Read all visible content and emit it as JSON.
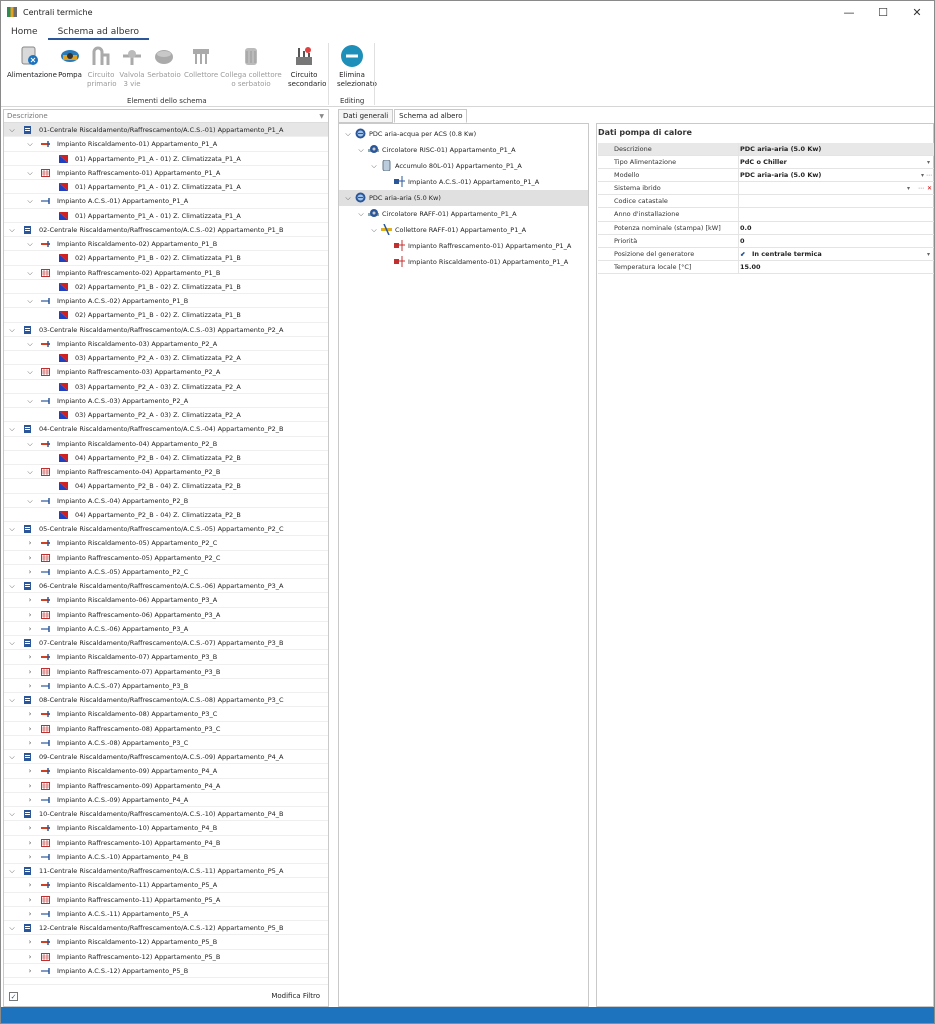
{
  "window": {
    "title": "Centrali termiche",
    "minimize": "—",
    "maximize": "☐",
    "close": "✕"
  },
  "menu": {
    "tabs": [
      "Home",
      "Schema ad albero"
    ]
  },
  "ribbon": {
    "buttons": [
      {
        "l1": "Alimentazione",
        "l2": "",
        "enabled": true,
        "icon": "power-supply-icon"
      },
      {
        "l1": "Pompa",
        "l2": "",
        "enabled": true,
        "icon": "pump-icon"
      },
      {
        "l1": "Circuito",
        "l2": "primario",
        "enabled": false,
        "icon": "primary-circuit-icon"
      },
      {
        "l1": "Valvola",
        "l2": "3 vie",
        "enabled": false,
        "icon": "three-way-valve-icon"
      },
      {
        "l1": "Serbatoio",
        "l2": "",
        "enabled": false,
        "icon": "tank-icon"
      },
      {
        "l1": "Collettore",
        "l2": "",
        "enabled": false,
        "icon": "manifold-icon"
      },
      {
        "l1": "Collega collettore",
        "l2": "o serbatoio",
        "enabled": false,
        "icon": "link-manifold-icon"
      },
      {
        "l1": "Circuito",
        "l2": "secondario",
        "enabled": true,
        "icon": "secondary-circuit-icon"
      },
      {
        "l1": "Elimina",
        "l2": "selezionato",
        "enabled": true,
        "icon": "delete-icon"
      }
    ],
    "groups": [
      "Elementi dello schema",
      "Editing"
    ]
  },
  "left": {
    "header": "Descrizione",
    "rows": [
      {
        "t": "c",
        "x": "01-Centrale Riscaldamento/Raffrescamento/A.C.S.-01) Appartamento_P1_A",
        "o": 1
      },
      {
        "t": "h",
        "x": "Impianto Riscaldamento-01) Appartamento_P1_A",
        "o": 1
      },
      {
        "t": "z",
        "x": "01) Appartamento_P1_A - 01) Z. Climatizzata_P1_A"
      },
      {
        "t": "r",
        "x": "Impianto Raffrescamento-01) Appartamento_P1_A",
        "o": 1
      },
      {
        "t": "z",
        "x": "01) Appartamento_P1_A - 01) Z. Climatizzata_P1_A"
      },
      {
        "t": "a",
        "x": "Impianto A.C.S.-01) Appartamento_P1_A",
        "o": 1
      },
      {
        "t": "z",
        "x": "01) Appartamento_P1_A - 01) Z. Climatizzata_P1_A"
      },
      {
        "t": "c",
        "x": "02-Centrale Riscaldamento/Raffrescamento/A.C.S.-02) Appartamento_P1_B",
        "o": 1
      },
      {
        "t": "h",
        "x": "Impianto Riscaldamento-02) Appartamento_P1_B",
        "o": 1
      },
      {
        "t": "z",
        "x": "02) Appartamento_P1_B - 02) Z. Climatizzata_P1_B"
      },
      {
        "t": "r",
        "x": "Impianto Raffrescamento-02) Appartamento_P1_B",
        "o": 1
      },
      {
        "t": "z",
        "x": "02) Appartamento_P1_B - 02) Z. Climatizzata_P1_B"
      },
      {
        "t": "a",
        "x": "Impianto A.C.S.-02) Appartamento_P1_B",
        "o": 1
      },
      {
        "t": "z",
        "x": "02) Appartamento_P1_B - 02) Z. Climatizzata_P1_B"
      },
      {
        "t": "c",
        "x": "03-Centrale Riscaldamento/Raffrescamento/A.C.S.-03) Appartamento_P2_A",
        "o": 1
      },
      {
        "t": "h",
        "x": "Impianto Riscaldamento-03) Appartamento_P2_A",
        "o": 1
      },
      {
        "t": "z",
        "x": "03) Appartamento_P2_A - 03) Z. Climatizzata_P2_A"
      },
      {
        "t": "r",
        "x": "Impianto Raffrescamento-03) Appartamento_P2_A",
        "o": 1
      },
      {
        "t": "z",
        "x": "03) Appartamento_P2_A - 03) Z. Climatizzata_P2_A"
      },
      {
        "t": "a",
        "x": "Impianto A.C.S.-03) Appartamento_P2_A",
        "o": 1
      },
      {
        "t": "z",
        "x": "03) Appartamento_P2_A - 03) Z. Climatizzata_P2_A"
      },
      {
        "t": "c",
        "x": "04-Centrale Riscaldamento/Raffrescamento/A.C.S.-04) Appartamento_P2_B",
        "o": 1
      },
      {
        "t": "h",
        "x": "Impianto Riscaldamento-04) Appartamento_P2_B",
        "o": 1
      },
      {
        "t": "z",
        "x": "04) Appartamento_P2_B - 04) Z. Climatizzata_P2_B"
      },
      {
        "t": "r",
        "x": "Impianto Raffrescamento-04) Appartamento_P2_B",
        "o": 1
      },
      {
        "t": "z",
        "x": "04) Appartamento_P2_B - 04) Z. Climatizzata_P2_B"
      },
      {
        "t": "a",
        "x": "Impianto A.C.S.-04) Appartamento_P2_B",
        "o": 1
      },
      {
        "t": "z",
        "x": "04) Appartamento_P2_B - 04) Z. Climatizzata_P2_B"
      },
      {
        "t": "c",
        "x": "05-Centrale Riscaldamento/Raffrescamento/A.C.S.-05) Appartamento_P2_C",
        "o": 1
      },
      {
        "t": "h",
        "x": "Impianto Riscaldamento-05) Appartamento_P2_C",
        "o": 0
      },
      {
        "t": "r",
        "x": "Impianto Raffrescamento-05) Appartamento_P2_C",
        "o": 0
      },
      {
        "t": "a",
        "x": "Impianto A.C.S.-05) Appartamento_P2_C",
        "o": 0
      },
      {
        "t": "c",
        "x": "06-Centrale Riscaldamento/Raffrescamento/A.C.S.-06) Appartamento_P3_A",
        "o": 1
      },
      {
        "t": "h",
        "x": "Impianto Riscaldamento-06) Appartamento_P3_A",
        "o": 0
      },
      {
        "t": "r",
        "x": "Impianto Raffrescamento-06) Appartamento_P3_A",
        "o": 0
      },
      {
        "t": "a",
        "x": "Impianto A.C.S.-06) Appartamento_P3_A",
        "o": 0
      },
      {
        "t": "c",
        "x": "07-Centrale Riscaldamento/Raffrescamento/A.C.S.-07) Appartamento_P3_B",
        "o": 1
      },
      {
        "t": "h",
        "x": "Impianto Riscaldamento-07) Appartamento_P3_B",
        "o": 0
      },
      {
        "t": "r",
        "x": "Impianto Raffrescamento-07) Appartamento_P3_B",
        "o": 0
      },
      {
        "t": "a",
        "x": "Impianto A.C.S.-07) Appartamento_P3_B",
        "o": 0
      },
      {
        "t": "c",
        "x": "08-Centrale Riscaldamento/Raffrescamento/A.C.S.-08) Appartamento_P3_C",
        "o": 1
      },
      {
        "t": "h",
        "x": "Impianto Riscaldamento-08) Appartamento_P3_C",
        "o": 0
      },
      {
        "t": "r",
        "x": "Impianto Raffrescamento-08) Appartamento_P3_C",
        "o": 0
      },
      {
        "t": "a",
        "x": "Impianto A.C.S.-08) Appartamento_P3_C",
        "o": 0
      },
      {
        "t": "c",
        "x": "09-Centrale Riscaldamento/Raffrescamento/A.C.S.-09) Appartamento_P4_A",
        "o": 1
      },
      {
        "t": "h",
        "x": "Impianto Riscaldamento-09) Appartamento_P4_A",
        "o": 0
      },
      {
        "t": "r",
        "x": "Impianto Raffrescamento-09) Appartamento_P4_A",
        "o": 0
      },
      {
        "t": "a",
        "x": "Impianto A.C.S.-09) Appartamento_P4_A",
        "o": 0
      },
      {
        "t": "c",
        "x": "10-Centrale Riscaldamento/Raffrescamento/A.C.S.-10) Appartamento_P4_B",
        "o": 1
      },
      {
        "t": "h",
        "x": "Impianto Riscaldamento-10) Appartamento_P4_B",
        "o": 0
      },
      {
        "t": "r",
        "x": "Impianto Raffrescamento-10) Appartamento_P4_B",
        "o": 0
      },
      {
        "t": "a",
        "x": "Impianto A.C.S.-10) Appartamento_P4_B",
        "o": 0
      },
      {
        "t": "c",
        "x": "11-Centrale Riscaldamento/Raffrescamento/A.C.S.-11) Appartamento_P5_A",
        "o": 1
      },
      {
        "t": "h",
        "x": "Impianto Riscaldamento-11) Appartamento_P5_A",
        "o": 0
      },
      {
        "t": "r",
        "x": "Impianto Raffrescamento-11) Appartamento_P5_A",
        "o": 0
      },
      {
        "t": "a",
        "x": "Impianto A.C.S.-11) Appartamento_P5_A",
        "o": 0
      },
      {
        "t": "c",
        "x": "12-Centrale Riscaldamento/Raffrescamento/A.C.S.-12) Appartamento_P5_B",
        "o": 1
      },
      {
        "t": "h",
        "x": "Impianto Riscaldamento-12) Appartamento_P5_B",
        "o": 0
      },
      {
        "t": "r",
        "x": "Impianto Raffrescamento-12) Appartamento_P5_B",
        "o": 0
      },
      {
        "t": "a",
        "x": "Impianto A.C.S.-12) Appartamento_P5_B",
        "o": 0
      }
    ],
    "footer": {
      "checkbox": "✓",
      "filter": "Modifica Filtro"
    }
  },
  "right_tabs": [
    "Dati generali",
    "Schema ad albero"
  ],
  "tree": [
    {
      "x": "PDC aria-acqua per ACS (0.8 Kw)",
      "lvl": 0,
      "icon": "heat-pump-icon",
      "o": 1
    },
    {
      "x": "Circolatore RISC-01) Appartamento_P1_A",
      "lvl": 1,
      "icon": "circulator-icon",
      "o": 1
    },
    {
      "x": "Accumulo 80L-01) Appartamento_P1_A",
      "lvl": 2,
      "icon": "storage-tank-icon",
      "o": 1
    },
    {
      "x": "Impianto A.C.S.-01) Appartamento_P1_A",
      "lvl": 3,
      "icon": "dhw-system-icon",
      "o": -1
    },
    {
      "x": "PDC aria-aria (5.0 Kw)",
      "lvl": 0,
      "icon": "heat-pump-icon",
      "o": 1,
      "sel": 1
    },
    {
      "x": "Circolatore RAFF-01) Appartamento_P1_A",
      "lvl": 1,
      "icon": "circulator-icon",
      "o": 1
    },
    {
      "x": "Collettore RAFF-01) Appartamento_P1_A",
      "lvl": 2,
      "icon": "manifold-icon",
      "o": 1
    },
    {
      "x": "Impianto Raffrescamento-01) Appartamento_P1_A",
      "lvl": 3,
      "icon": "cooling-system-icon",
      "o": -1
    },
    {
      "x": "Impianto Riscaldamento-01) Appartamento_P1_A",
      "lvl": 3,
      "icon": "heating-system-icon",
      "o": -1
    }
  ],
  "props": {
    "title": "Dati pompa di calore",
    "rows": [
      {
        "k": "Descrizione",
        "v": "PDC aria-aria (5.0 Kw)",
        "sel": 1
      },
      {
        "k": "Tipo Alimentazione",
        "v": "PdC o Chiller",
        "dd": 1
      },
      {
        "k": "Modello",
        "v": "PDC aria-aria (5.0 Kw)",
        "dd": 1,
        "more": 1
      },
      {
        "k": "Sistema ibrido",
        "v": "",
        "dd": 1,
        "more": 1,
        "x": 1
      },
      {
        "k": "Codice catastale",
        "v": ""
      },
      {
        "k": "Anno d'installazione",
        "v": ""
      },
      {
        "k": "Potenza nominale (stampa) [kW]",
        "v": "0.0"
      },
      {
        "k": "Priorità",
        "v": "0"
      },
      {
        "k": "Posizione del generatore",
        "v": "In centrale termica",
        "dd": 1,
        "ic": 1
      },
      {
        "k": "Temperatura locale [°C]",
        "v": "15.00"
      }
    ]
  },
  "colors": {
    "accent": "#2b579a",
    "status": "#1e73be",
    "delete": "#1d8fb8"
  }
}
